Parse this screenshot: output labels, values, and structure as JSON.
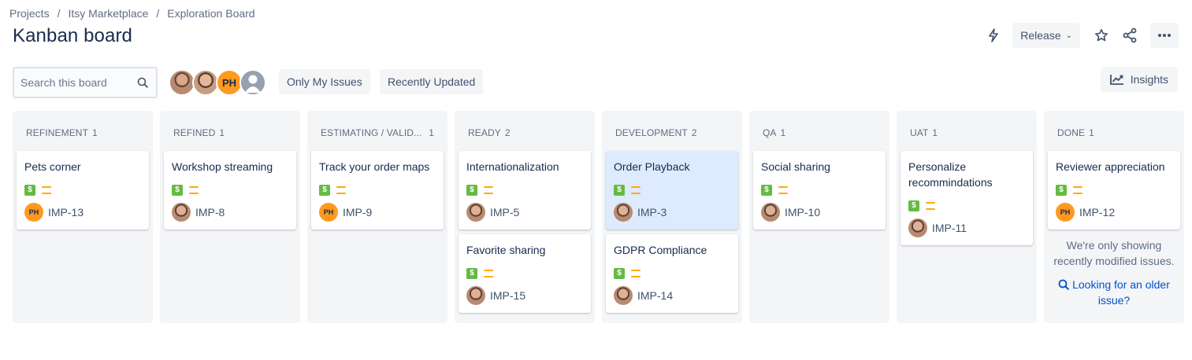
{
  "breadcrumb": [
    "Projects",
    "Itsy Marketplace",
    "Exploration Board"
  ],
  "title": "Kanban board",
  "header": {
    "release_label": "Release",
    "icons": [
      "automation-icon",
      "star-icon",
      "share-icon",
      "more-icon"
    ]
  },
  "toolbar": {
    "search_placeholder": "Search this board",
    "avatar_initials": "PH",
    "filters": [
      "Only My Issues",
      "Recently Updated"
    ],
    "insights_label": "Insights"
  },
  "columns": [
    {
      "name": "REFINEMENT",
      "count": "1",
      "cards": [
        {
          "title": "Pets corner",
          "key": "IMP-13",
          "avatar": "PH"
        }
      ]
    },
    {
      "name": "REFINED",
      "count": "1",
      "cards": [
        {
          "title": "Workshop streaming",
          "key": "IMP-8",
          "avatar": "photo"
        }
      ]
    },
    {
      "name": "ESTIMATING / VALID...",
      "count": "1",
      "cards": [
        {
          "title": "Track your order maps",
          "key": "IMP-9",
          "avatar": "PH"
        }
      ]
    },
    {
      "name": "READY",
      "count": "2",
      "cards": [
        {
          "title": "Internationalization",
          "key": "IMP-5",
          "avatar": "photo"
        },
        {
          "title": "Favorite sharing",
          "key": "IMP-15",
          "avatar": "photo"
        }
      ]
    },
    {
      "name": "DEVELOPMENT",
      "count": "2",
      "cards": [
        {
          "title": "Order Playback",
          "key": "IMP-3",
          "avatar": "photo",
          "selected": true
        },
        {
          "title": "GDPR Compliance",
          "key": "IMP-14",
          "avatar": "photo"
        }
      ]
    },
    {
      "name": "QA",
      "count": "1",
      "cards": [
        {
          "title": "Social sharing",
          "key": "IMP-10",
          "avatar": "photo"
        }
      ]
    },
    {
      "name": "UAT",
      "count": "1",
      "cards": [
        {
          "title": "Personalize recommindations",
          "key": "IMP-11",
          "avatar": "photo"
        }
      ]
    },
    {
      "name": "DONE",
      "count": "1",
      "cards": [
        {
          "title": "Reviewer appreciation",
          "key": "IMP-12",
          "avatar": "PH"
        }
      ]
    }
  ],
  "done_note": "We're only showing recently modified issues.",
  "older_link": "Looking for an older issue?",
  "colors": {
    "story": "#65ba43",
    "priority": "#ffab00",
    "selected_card": "#deebff",
    "link": "#0052cc",
    "avatar_ph": "#ff991f"
  }
}
